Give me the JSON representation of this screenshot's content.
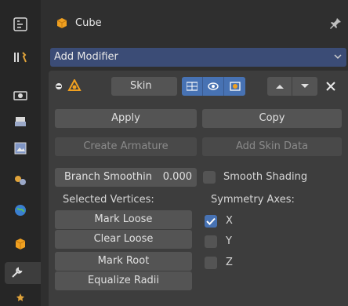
{
  "header": {
    "object_name": "Cube"
  },
  "add_modifier": {
    "label": "Add Modifier"
  },
  "modifier": {
    "name": "Skin",
    "apply_label": "Apply",
    "copy_label": "Copy",
    "create_armature_label": "Create Armature",
    "add_skin_data_label": "Add Skin Data",
    "branch_smoothing_label": "Branch Smoothin",
    "branch_smoothing_value": "0.000",
    "smooth_shading_label": "Smooth Shading",
    "smooth_shading_checked": false,
    "selected_vertices_label": "Selected Vertices:",
    "symmetry_axes_label": "Symmetry Axes:",
    "mark_loose_label": "Mark Loose",
    "clear_loose_label": "Clear Loose",
    "mark_root_label": "Mark Root",
    "equalize_radii_label": "Equalize Radii",
    "axes": [
      {
        "label": "X",
        "checked": true
      },
      {
        "label": "Y",
        "checked": false
      },
      {
        "label": "Z",
        "checked": false
      }
    ]
  },
  "tabs": [
    "tool",
    "render",
    "output",
    "view-layer",
    "scene",
    "world",
    "object",
    "modifiers",
    "particles"
  ],
  "colors": {
    "accent": "#4772b3",
    "dropdown": "#3b4c76",
    "panel": "#3d3d3d",
    "button": "#545454",
    "orange": "#f0a020"
  }
}
